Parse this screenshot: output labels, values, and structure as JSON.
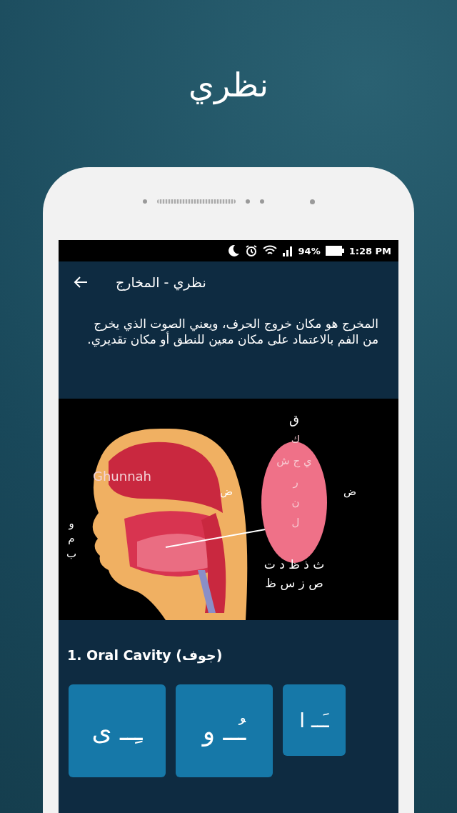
{
  "headline": "نظري",
  "status_bar": {
    "battery": "94%",
    "time": "1:28 PM"
  },
  "app_bar": {
    "title": "نظري - المخارج"
  },
  "intro": "المخرج هو مكان خروج الحرف، ويعني الصوت الذي يخرج من الفم بالاعتماد على مكان معين للنطق أو مكان تقديري.",
  "diagram": {
    "label": "Ghunnah",
    "letters": [
      "ق",
      "ك",
      "ي ج ش",
      "ر",
      "ن",
      "ل",
      "ض",
      "ض",
      "ث ذ ظ د ت",
      "ص ز س ظ",
      "و",
      "م",
      "ب"
    ]
  },
  "section": {
    "title": "1. Oral Cavity (جوف)"
  },
  "tiles": [
    {
      "text": "ـَــ ا",
      "kind": "short"
    },
    {
      "text": "ـُــ و",
      "kind": "tall"
    },
    {
      "text": "ـِــ ى",
      "kind": "tall"
    }
  ]
}
